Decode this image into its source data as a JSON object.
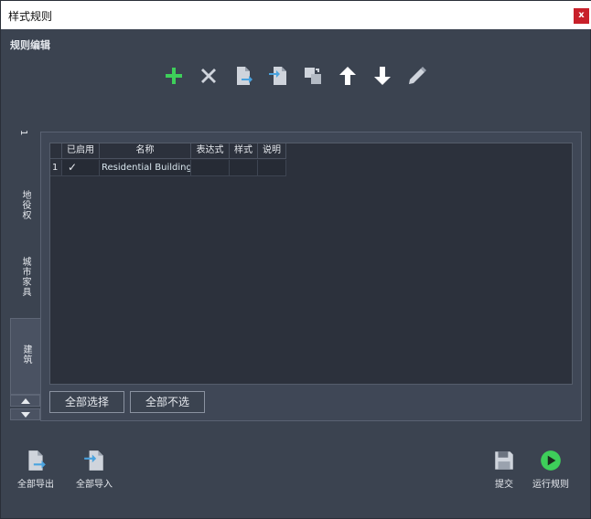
{
  "window": {
    "title": "样式规则",
    "close_label": "x"
  },
  "section_label": "规则编辑",
  "toolbar": {
    "items": [
      {
        "icon": "plus-icon",
        "color": "#3ecf5a"
      },
      {
        "icon": "x-icon",
        "color": "#cfd4dc"
      },
      {
        "icon": "file-export-icon",
        "color": "#cfd4dc"
      },
      {
        "icon": "file-import-icon",
        "color": "#cfd4dc"
      },
      {
        "icon": "duplicate-icon",
        "color": "#cfd4dc"
      },
      {
        "icon": "arrow-up-icon",
        "color": "#ffffff"
      },
      {
        "icon": "arrow-down-icon",
        "color": "#ffffff"
      },
      {
        "icon": "pencil-icon",
        "color": "#cfd4dc"
      }
    ]
  },
  "tabs": [
    {
      "label": "1"
    },
    {
      "label": "地役权"
    },
    {
      "label": "城市家具"
    },
    {
      "label": "建筑",
      "active": true
    }
  ],
  "table": {
    "columns": [
      "",
      "已启用",
      "名称",
      "表达式",
      "样式",
      "说明"
    ],
    "rows": [
      {
        "index": "1",
        "enabled": "✓",
        "name": "Residential Buildings",
        "expression": "",
        "style": "",
        "description": ""
      }
    ]
  },
  "buttons": {
    "select_all": "全部选择",
    "deselect_all": "全部不选"
  },
  "footer": {
    "export_all": "全部导出",
    "import_all": "全部导入",
    "submit": "提交",
    "run_rules": "运行规则"
  },
  "colors": {
    "background": "#3b4350",
    "accent_green": "#3ecf5a",
    "close_red": "#c8202a"
  }
}
